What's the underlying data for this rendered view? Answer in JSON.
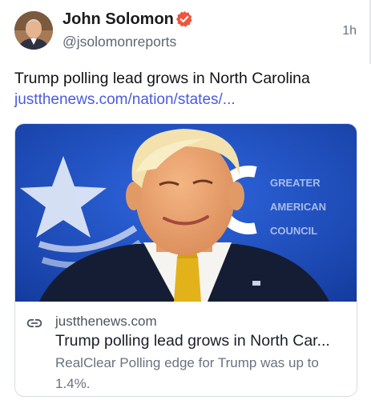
{
  "author": {
    "name": "John Solomon",
    "handle": "@jsolomonreports",
    "verified_color": "#f0543c",
    "avatar_icon": "user-avatar"
  },
  "post": {
    "time": "1h",
    "text": "Trump polling lead grows in North Carolina",
    "link": "justthenews.com/nation/states/..."
  },
  "card": {
    "link_icon": "link-icon",
    "domain": "justthenews.com",
    "title": "Trump polling lead grows in North Car...",
    "description": "RealClear Polling edge for Trump was up to 1.4%.",
    "backdrop_text": [
      "GREATER",
      "AMERICAN",
      "COUNCIL"
    ]
  },
  "colors": {
    "link": "#4a5be0",
    "backdrop_blue": "#1d4fc2"
  }
}
